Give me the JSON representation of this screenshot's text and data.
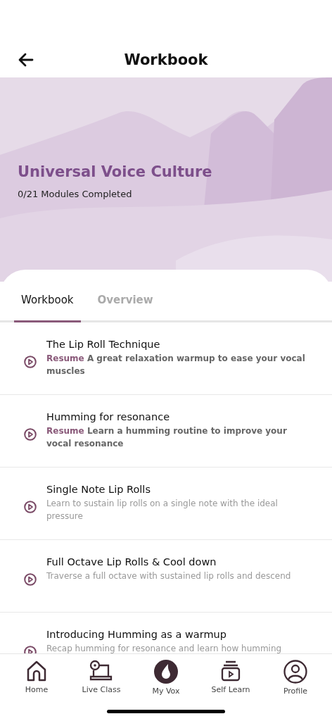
{
  "header": {
    "title": "Workbook"
  },
  "course": {
    "title": "Universal Voice Culture",
    "progress": "0/21 Modules Completed"
  },
  "tabs": [
    {
      "label": "Workbook",
      "selected": true
    },
    {
      "label": "Overview",
      "selected": false
    }
  ],
  "lessons": [
    {
      "title": "The Lip Roll Technique",
      "status": "Resume",
      "description": "A great relaxation warmup to ease your vocal muscles"
    },
    {
      "title": "Humming for resonance",
      "status": "Resume",
      "description": "Learn a humming routine to improve your vocal resonance"
    },
    {
      "title": "Single Note Lip Rolls",
      "description": "Learn to sustain lip rolls on a single note with the ideal pressure"
    },
    {
      "title": "Full Octave Lip Rolls & Cool down",
      "description": "Traverse a full octave with sustained lip rolls and descend"
    },
    {
      "title": "Introducing Humming as a warmup",
      "description": "Recap humming for resonance and learn how humming"
    }
  ],
  "nav": [
    {
      "kind": "home",
      "label": "Home"
    },
    {
      "kind": "live",
      "label": "Live Class"
    },
    {
      "kind": "vox",
      "label": "My Vox"
    },
    {
      "kind": "self",
      "label": "Self Learn"
    },
    {
      "kind": "profile",
      "label": "Profile"
    }
  ]
}
